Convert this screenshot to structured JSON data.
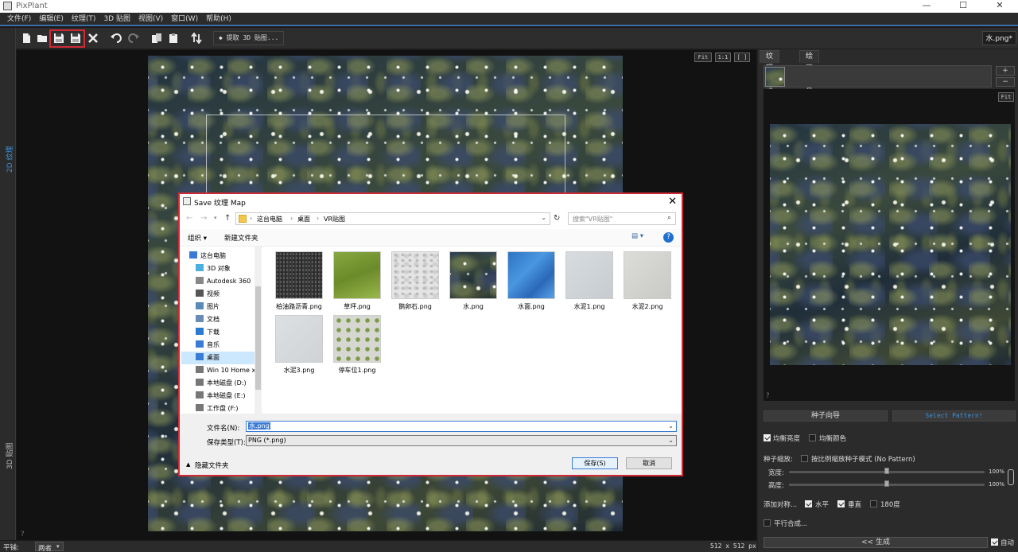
{
  "app": {
    "title": "PixPlant",
    "window_buttons": [
      "—",
      "☐",
      "✕"
    ]
  },
  "menu": [
    "文件(F)",
    "编辑(E)",
    "纹理(T)",
    "3D 贴图",
    "视图(V)",
    "窗口(W)",
    "帮助(H)"
  ],
  "left_strip": {
    "top_label": "2D 纹理",
    "bottom_label": "3D 贴图"
  },
  "toolbar": {
    "extract_label": "提取 3D 贴图...",
    "file_name": "水.png*"
  },
  "canvas": {
    "fit_label": "Fit",
    "one_label": "1:1",
    "full_label": "[ ]"
  },
  "status": {
    "tile_label": "平铺:",
    "tile_value": "两者",
    "size": "512 x 512 px",
    "help": "?"
  },
  "right_panel": {
    "tabs": [
      "纹理合成",
      "绘画工具"
    ],
    "plus": "+",
    "minus": "−",
    "fit": "Fit",
    "help": "?",
    "seed_guide_btn": "种子向导",
    "select_pattern_btn": "Select Pattern!",
    "balance_brightness": "均衡亮度",
    "balance_color": "均衡颜色",
    "seed_scale_label": "种子缩放:",
    "proportional_label": "按比例缩放种子模式 (No Pattern)",
    "width_label": "宽度:",
    "width_value": "100%",
    "width_level": 0.5,
    "height_label": "高度:",
    "height_value": "100%",
    "height_level": 0.5,
    "add_symmetry": "添加对称...",
    "horizontal": "水平",
    "vertical": "垂直",
    "deg180": "180度",
    "parallel": "平行合成...",
    "generate_btn": "<< 生成",
    "auto_label": "自动"
  },
  "dialog": {
    "title": "Save 纹理 Map",
    "breadcrumb": [
      "这台电脑",
      "桌面",
      "VR贴图"
    ],
    "search_placeholder": "搜索\"VR贴图\"",
    "organize": "组织 ▾",
    "new_folder": "新建文件夹",
    "nav_items": [
      {
        "label": "这台电脑",
        "icon": "computer-icon"
      },
      {
        "label": "3D 对象",
        "icon": "3d-objects-icon"
      },
      {
        "label": "Autodesk 360",
        "icon": "cloud-icon"
      },
      {
        "label": "视频",
        "icon": "video-icon"
      },
      {
        "label": "图片",
        "icon": "pictures-icon"
      },
      {
        "label": "文档",
        "icon": "documents-icon"
      },
      {
        "label": "下载",
        "icon": "download-icon"
      },
      {
        "label": "音乐",
        "icon": "music-icon"
      },
      {
        "label": "桌面",
        "icon": "desktop-icon"
      },
      {
        "label": "Win 10 Home x",
        "icon": "drive-icon"
      },
      {
        "label": "本地磁盘 (D:)",
        "icon": "drive-icon"
      },
      {
        "label": "本地磁盘 (E:)",
        "icon": "drive-icon"
      },
      {
        "label": "工作盘 (F:)",
        "icon": "drive-icon"
      }
    ],
    "files": [
      {
        "name": "柏油路沥青.png",
        "swatch": "asphalt"
      },
      {
        "name": "草坪.png",
        "swatch": "grass"
      },
      {
        "name": "鹅卵石.png",
        "swatch": "pebble"
      },
      {
        "name": "水.png",
        "swatch": "water"
      },
      {
        "name": "水面.png",
        "swatch": "watersurface"
      },
      {
        "name": "水泥1.png",
        "swatch": "cement1"
      },
      {
        "name": "水泥2.png",
        "swatch": "cement2"
      },
      {
        "name": "水泥3.png",
        "swatch": "cement3"
      },
      {
        "name": "停车位1.png",
        "swatch": "parking"
      }
    ],
    "filename_label": "文件名(N):",
    "filename_value": "水.png",
    "filetype_label": "保存类型(T):",
    "filetype_value": "PNG (*.png)",
    "hide_folders": "隐藏文件夹",
    "save_btn": "保存(S)",
    "cancel_btn": "取消"
  },
  "colors": {
    "accent": "#3a6ea5",
    "highlight": "#d02a35",
    "select_pattern_text": "#3b8fd8"
  }
}
